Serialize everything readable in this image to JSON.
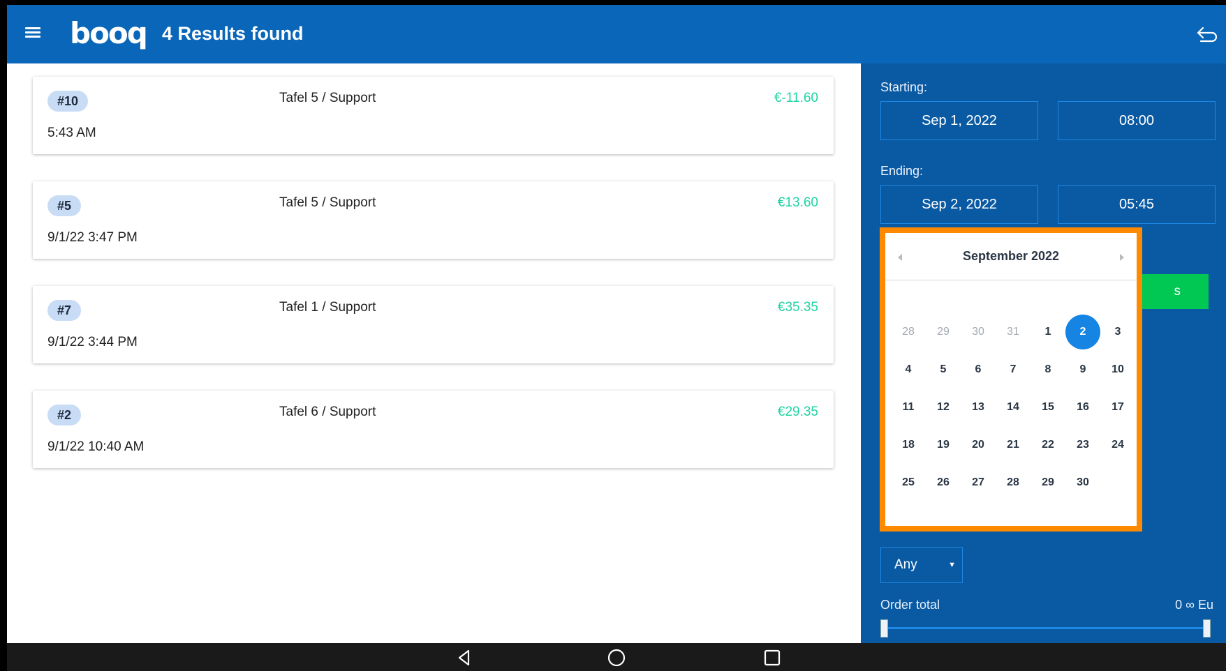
{
  "header": {
    "logo": "booq",
    "title": "4 Results found"
  },
  "orders": [
    {
      "number": "#10",
      "time": "5:43 AM",
      "table": "Tafel 5 / Support",
      "amount": "€-11.60"
    },
    {
      "number": "#5",
      "time": "9/1/22 3:47 PM",
      "table": "Tafel 5 / Support",
      "amount": "€13.60"
    },
    {
      "number": "#7",
      "time": "9/1/22 3:44 PM",
      "table": "Tafel 1 / Support",
      "amount": "€35.35"
    },
    {
      "number": "#2",
      "time": "9/1/22 10:40 AM",
      "table": "Tafel 6 / Support",
      "amount": "€29.35"
    }
  ],
  "filters": {
    "starting_label": "Starting:",
    "start_date": "Sep 1, 2022",
    "start_time": "08:00",
    "ending_label": "Ending:",
    "end_date": "Sep 2, 2022",
    "end_time": "05:45",
    "partial_button_text": "s",
    "select_value": "Any",
    "order_total_label": "Order total",
    "order_total_range": "0 ∞ Eu"
  },
  "calendar": {
    "title": "September 2022",
    "selected_day": "2",
    "weeks": [
      [
        [
          "28",
          true
        ],
        [
          "29",
          true
        ],
        [
          "30",
          true
        ],
        [
          "31",
          true
        ],
        [
          "1",
          false
        ],
        [
          "2",
          false
        ],
        [
          "3",
          false
        ]
      ],
      [
        [
          "4",
          false
        ],
        [
          "5",
          false
        ],
        [
          "6",
          false
        ],
        [
          "7",
          false
        ],
        [
          "8",
          false
        ],
        [
          "9",
          false
        ],
        [
          "10",
          false
        ]
      ],
      [
        [
          "11",
          false
        ],
        [
          "12",
          false
        ],
        [
          "13",
          false
        ],
        [
          "14",
          false
        ],
        [
          "15",
          false
        ],
        [
          "16",
          false
        ],
        [
          "17",
          false
        ]
      ],
      [
        [
          "18",
          false
        ],
        [
          "19",
          false
        ],
        [
          "20",
          false
        ],
        [
          "21",
          false
        ],
        [
          "22",
          false
        ],
        [
          "23",
          false
        ],
        [
          "24",
          false
        ]
      ],
      [
        [
          "25",
          false
        ],
        [
          "26",
          false
        ],
        [
          "27",
          false
        ],
        [
          "28",
          false
        ],
        [
          "29",
          false
        ],
        [
          "30",
          false
        ]
      ]
    ]
  },
  "colors": {
    "appbar": "#0a66b8",
    "panel": "#0a5aa3",
    "amount": "#1fd3a2",
    "highlight_border": "#ff8a00",
    "selected_day": "#1584e3",
    "green_button": "#00c853"
  },
  "icons": {
    "menu": "menu-icon",
    "back": "back-arrow-icon",
    "nav_back": "nav-back-icon",
    "nav_home": "nav-home-icon",
    "nav_recents": "nav-recents-icon"
  }
}
